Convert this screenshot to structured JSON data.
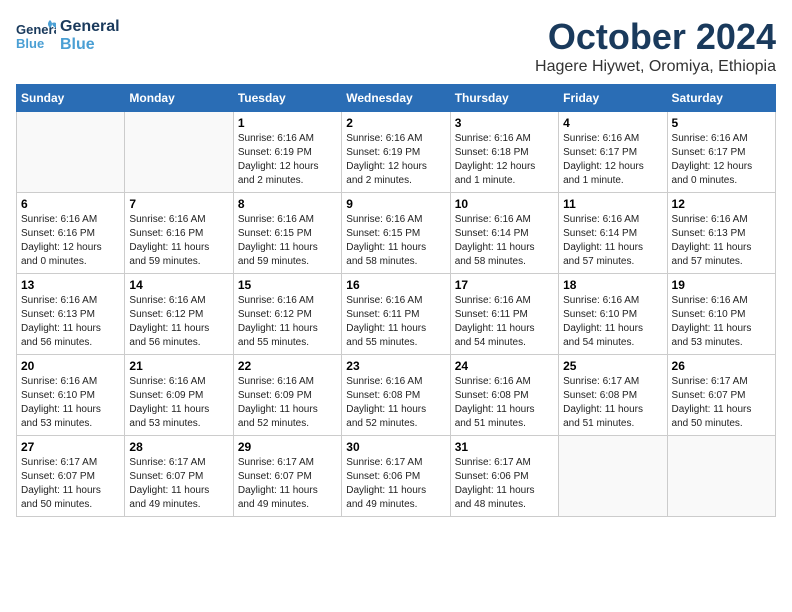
{
  "header": {
    "logo_line1": "General",
    "logo_line2": "Blue",
    "month_title": "October 2024",
    "subtitle": "Hagere Hiywet, Oromiya, Ethiopia"
  },
  "weekdays": [
    "Sunday",
    "Monday",
    "Tuesday",
    "Wednesday",
    "Thursday",
    "Friday",
    "Saturday"
  ],
  "weeks": [
    [
      {
        "day": "",
        "info": ""
      },
      {
        "day": "",
        "info": ""
      },
      {
        "day": "1",
        "info": "Sunrise: 6:16 AM\nSunset: 6:19 PM\nDaylight: 12 hours\nand 2 minutes."
      },
      {
        "day": "2",
        "info": "Sunrise: 6:16 AM\nSunset: 6:19 PM\nDaylight: 12 hours\nand 2 minutes."
      },
      {
        "day": "3",
        "info": "Sunrise: 6:16 AM\nSunset: 6:18 PM\nDaylight: 12 hours\nand 1 minute."
      },
      {
        "day": "4",
        "info": "Sunrise: 6:16 AM\nSunset: 6:17 PM\nDaylight: 12 hours\nand 1 minute."
      },
      {
        "day": "5",
        "info": "Sunrise: 6:16 AM\nSunset: 6:17 PM\nDaylight: 12 hours\nand 0 minutes."
      }
    ],
    [
      {
        "day": "6",
        "info": "Sunrise: 6:16 AM\nSunset: 6:16 PM\nDaylight: 12 hours\nand 0 minutes."
      },
      {
        "day": "7",
        "info": "Sunrise: 6:16 AM\nSunset: 6:16 PM\nDaylight: 11 hours\nand 59 minutes."
      },
      {
        "day": "8",
        "info": "Sunrise: 6:16 AM\nSunset: 6:15 PM\nDaylight: 11 hours\nand 59 minutes."
      },
      {
        "day": "9",
        "info": "Sunrise: 6:16 AM\nSunset: 6:15 PM\nDaylight: 11 hours\nand 58 minutes."
      },
      {
        "day": "10",
        "info": "Sunrise: 6:16 AM\nSunset: 6:14 PM\nDaylight: 11 hours\nand 58 minutes."
      },
      {
        "day": "11",
        "info": "Sunrise: 6:16 AM\nSunset: 6:14 PM\nDaylight: 11 hours\nand 57 minutes."
      },
      {
        "day": "12",
        "info": "Sunrise: 6:16 AM\nSunset: 6:13 PM\nDaylight: 11 hours\nand 57 minutes."
      }
    ],
    [
      {
        "day": "13",
        "info": "Sunrise: 6:16 AM\nSunset: 6:13 PM\nDaylight: 11 hours\nand 56 minutes."
      },
      {
        "day": "14",
        "info": "Sunrise: 6:16 AM\nSunset: 6:12 PM\nDaylight: 11 hours\nand 56 minutes."
      },
      {
        "day": "15",
        "info": "Sunrise: 6:16 AM\nSunset: 6:12 PM\nDaylight: 11 hours\nand 55 minutes."
      },
      {
        "day": "16",
        "info": "Sunrise: 6:16 AM\nSunset: 6:11 PM\nDaylight: 11 hours\nand 55 minutes."
      },
      {
        "day": "17",
        "info": "Sunrise: 6:16 AM\nSunset: 6:11 PM\nDaylight: 11 hours\nand 54 minutes."
      },
      {
        "day": "18",
        "info": "Sunrise: 6:16 AM\nSunset: 6:10 PM\nDaylight: 11 hours\nand 54 minutes."
      },
      {
        "day": "19",
        "info": "Sunrise: 6:16 AM\nSunset: 6:10 PM\nDaylight: 11 hours\nand 53 minutes."
      }
    ],
    [
      {
        "day": "20",
        "info": "Sunrise: 6:16 AM\nSunset: 6:10 PM\nDaylight: 11 hours\nand 53 minutes."
      },
      {
        "day": "21",
        "info": "Sunrise: 6:16 AM\nSunset: 6:09 PM\nDaylight: 11 hours\nand 53 minutes."
      },
      {
        "day": "22",
        "info": "Sunrise: 6:16 AM\nSunset: 6:09 PM\nDaylight: 11 hours\nand 52 minutes."
      },
      {
        "day": "23",
        "info": "Sunrise: 6:16 AM\nSunset: 6:08 PM\nDaylight: 11 hours\nand 52 minutes."
      },
      {
        "day": "24",
        "info": "Sunrise: 6:16 AM\nSunset: 6:08 PM\nDaylight: 11 hours\nand 51 minutes."
      },
      {
        "day": "25",
        "info": "Sunrise: 6:17 AM\nSunset: 6:08 PM\nDaylight: 11 hours\nand 51 minutes."
      },
      {
        "day": "26",
        "info": "Sunrise: 6:17 AM\nSunset: 6:07 PM\nDaylight: 11 hours\nand 50 minutes."
      }
    ],
    [
      {
        "day": "27",
        "info": "Sunrise: 6:17 AM\nSunset: 6:07 PM\nDaylight: 11 hours\nand 50 minutes."
      },
      {
        "day": "28",
        "info": "Sunrise: 6:17 AM\nSunset: 6:07 PM\nDaylight: 11 hours\nand 49 minutes."
      },
      {
        "day": "29",
        "info": "Sunrise: 6:17 AM\nSunset: 6:07 PM\nDaylight: 11 hours\nand 49 minutes."
      },
      {
        "day": "30",
        "info": "Sunrise: 6:17 AM\nSunset: 6:06 PM\nDaylight: 11 hours\nand 49 minutes."
      },
      {
        "day": "31",
        "info": "Sunrise: 6:17 AM\nSunset: 6:06 PM\nDaylight: 11 hours\nand 48 minutes."
      },
      {
        "day": "",
        "info": ""
      },
      {
        "day": "",
        "info": ""
      }
    ]
  ]
}
